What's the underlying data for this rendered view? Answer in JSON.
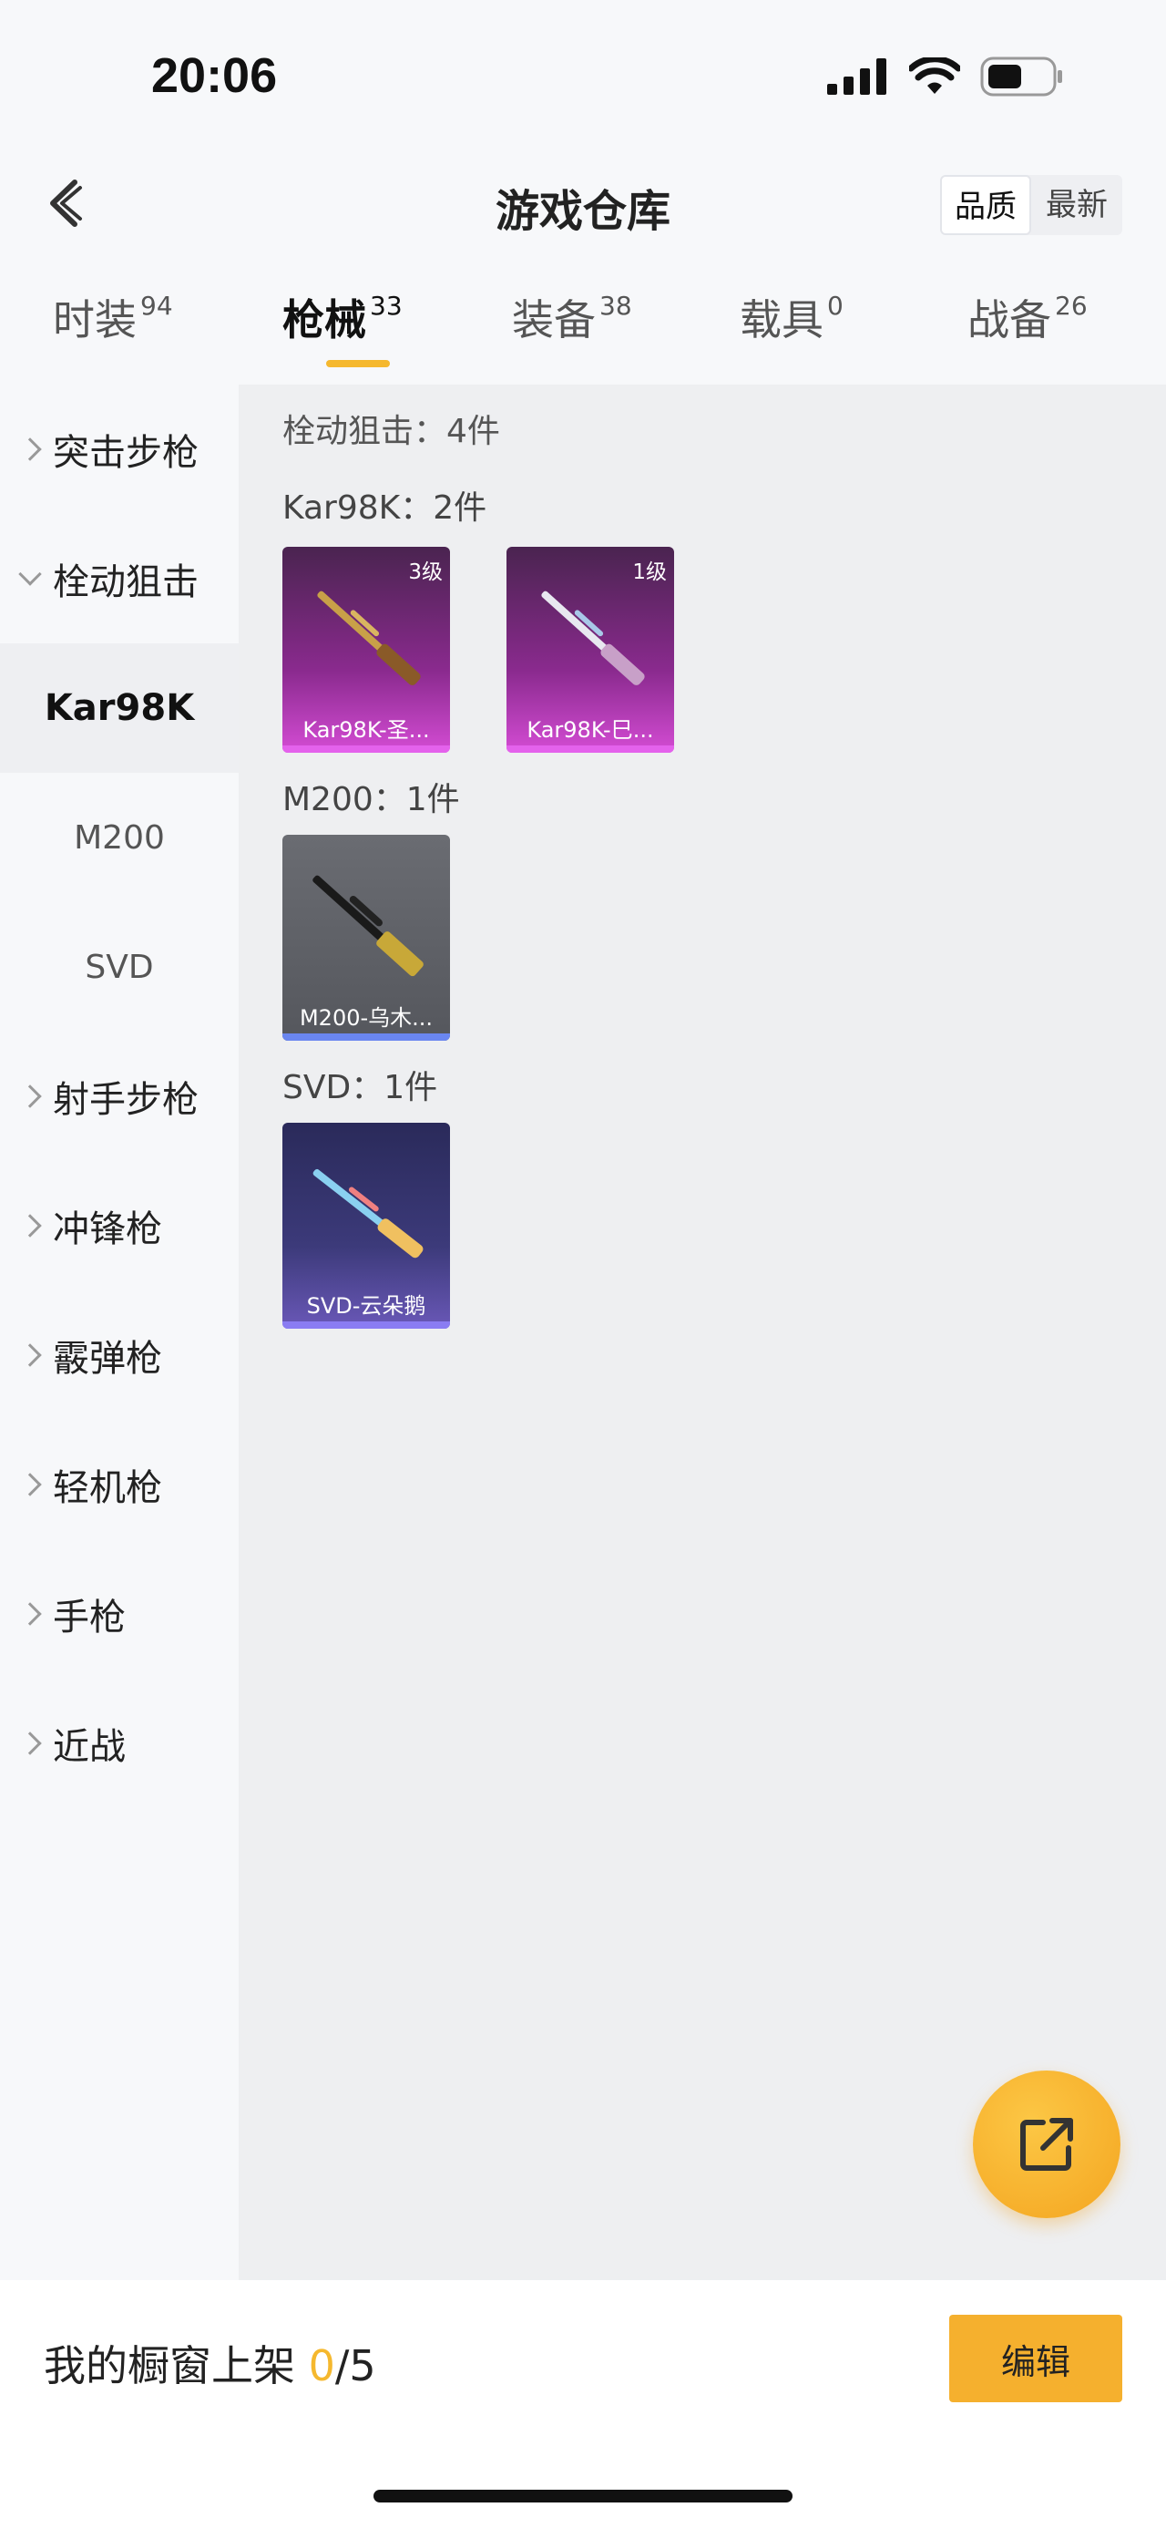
{
  "status": {
    "time": "20:06"
  },
  "header": {
    "title": "游戏仓库",
    "sort": [
      "品质",
      "最新"
    ]
  },
  "tabs": [
    {
      "label": "时装",
      "count": "94"
    },
    {
      "label": "枪械",
      "count": "33"
    },
    {
      "label": "装备",
      "count": "38"
    },
    {
      "label": "载具",
      "count": "0"
    },
    {
      "label": "战备",
      "count": "26"
    }
  ],
  "sidebar": {
    "categories": [
      "突击步枪",
      "栓动狙击",
      "射手步枪",
      "冲锋枪",
      "霰弹枪",
      "轻机枪",
      "手枪",
      "近战"
    ],
    "subitems": [
      "Kar98K",
      "M200",
      "SVD"
    ]
  },
  "content": {
    "section_title": "栓动狙击：4件",
    "groups": [
      {
        "title": "Kar98K：2件",
        "items": [
          {
            "name": "Kar98K-圣...",
            "level": "3级"
          },
          {
            "name": "Kar98K-巳...",
            "level": "1级"
          }
        ]
      },
      {
        "title": "M200：1件",
        "items": [
          {
            "name": "M200-乌木..."
          }
        ]
      },
      {
        "title": "SVD：1件",
        "items": [
          {
            "name": "SVD-云朵鹅"
          }
        ]
      }
    ]
  },
  "bottom": {
    "showcase_label": "我的橱窗上架 ",
    "showcase_count": "0",
    "showcase_total": "/5",
    "edit_label": "编辑"
  },
  "colors": {
    "accent": "#f5b82e",
    "purple_rarity": "#e462ec",
    "blue_rarity": "#6a86f0",
    "indigo_rarity": "#8a7cf2"
  },
  "icons": [
    "back-icon",
    "signal-icon",
    "wifi-icon",
    "battery-icon",
    "chevron-right-icon",
    "chevron-down-icon",
    "share-icon"
  ]
}
